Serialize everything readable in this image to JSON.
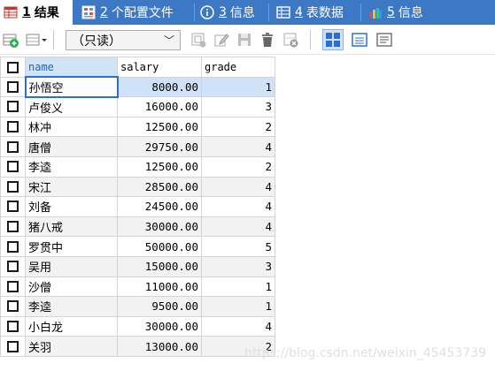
{
  "tabs": [
    {
      "num": "1",
      "label": "结果",
      "icon": "grid-result-icon",
      "active": true
    },
    {
      "num": "2",
      "label": "个配置文件",
      "icon": "profile-grid-icon",
      "active": false
    },
    {
      "num": "3",
      "label": "信息",
      "icon": "info-icon",
      "active": false
    },
    {
      "num": "4",
      "label": "表数据",
      "icon": "table-data-icon",
      "active": false
    },
    {
      "num": "5",
      "label": "信息",
      "icon": "info-chart-icon",
      "active": false
    }
  ],
  "toolbar": {
    "mode": "（只读）",
    "buttons": [
      "add-row-icon",
      "copy-row-icon",
      "import-icon",
      "save-icon",
      "delete-icon",
      "cancel-icon",
      "grid-view-icon",
      "form-view-icon",
      "text-view-icon"
    ]
  },
  "table": {
    "columns": [
      "name",
      "salary",
      "grade"
    ],
    "rows": [
      {
        "name": "孙悟空",
        "salary": "8000.00",
        "grade": "1"
      },
      {
        "name": "卢俊义",
        "salary": "16000.00",
        "grade": "3"
      },
      {
        "name": "林冲",
        "salary": "12500.00",
        "grade": "2"
      },
      {
        "name": "唐僧",
        "salary": "29750.00",
        "grade": "4"
      },
      {
        "name": "李逵",
        "salary": "12500.00",
        "grade": "2"
      },
      {
        "name": "宋江",
        "salary": "28500.00",
        "grade": "4"
      },
      {
        "name": "刘备",
        "salary": "24500.00",
        "grade": "4"
      },
      {
        "name": "猪八戒",
        "salary": "30000.00",
        "grade": "4"
      },
      {
        "name": "罗贯中",
        "salary": "50000.00",
        "grade": "5"
      },
      {
        "name": "吴用",
        "salary": "15000.00",
        "grade": "3"
      },
      {
        "name": "沙僧",
        "salary": "11000.00",
        "grade": "1"
      },
      {
        "name": "李逵",
        "salary": "9500.00",
        "grade": "1"
      },
      {
        "name": "小白龙",
        "salary": "30000.00",
        "grade": "4"
      },
      {
        "name": "关羽",
        "salary": "13000.00",
        "grade": "2"
      }
    ]
  },
  "watermark": "https://blog.csdn.net/weixin_45453739",
  "colors": {
    "tab_bar": "#3c78c4",
    "selection": "#cfe2f7",
    "header_highlight": "#cfe4f7"
  }
}
